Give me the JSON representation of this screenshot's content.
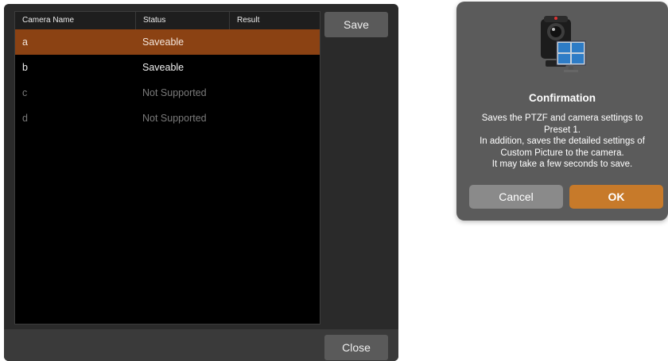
{
  "table": {
    "headers": [
      "Camera Name",
      "Status",
      "Result"
    ],
    "rows": [
      {
        "name": "a",
        "status": "Saveable",
        "result": ""
      },
      {
        "name": "b",
        "status": "Saveable",
        "result": ""
      },
      {
        "name": "c",
        "status": "Not Supported",
        "result": ""
      },
      {
        "name": "d",
        "status": "Not Supported",
        "result": ""
      }
    ]
  },
  "buttons": {
    "save": "Save",
    "close": "Close"
  },
  "dialog": {
    "title": "Confirmation",
    "message_lines": [
      "Saves the PTZF and camera settings to",
      "Preset 1.",
      "In addition, saves the detailed settings of",
      "Custom Picture to the camera.",
      "It may take a few seconds to save."
    ],
    "cancel": "Cancel",
    "ok": "OK",
    "icon": "ptz-camera-monitor-icon"
  },
  "colors": {
    "selected_row": "#8b4213",
    "ok_button": "#c77a2a",
    "cancel_button": "#8a8a8a",
    "dialog_bg": "#5b5b5b"
  }
}
